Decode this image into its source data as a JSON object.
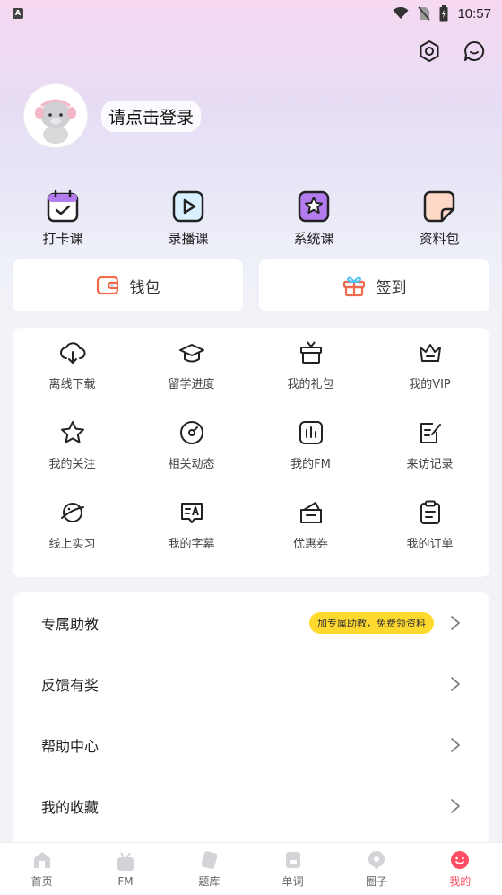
{
  "status_bar": {
    "time": "10:57",
    "badge": "A"
  },
  "profile": {
    "login_text": "请点击登录"
  },
  "quick_actions": [
    {
      "label": "打卡课",
      "icon": "calendar-check-icon"
    },
    {
      "label": "录播课",
      "icon": "play-icon"
    },
    {
      "label": "系统课",
      "icon": "star-box-icon"
    },
    {
      "label": "资料包",
      "icon": "note-icon"
    }
  ],
  "wallet": {
    "wallet_label": "钱包",
    "checkin_label": "签到"
  },
  "grid_items": [
    {
      "label": "离线下载",
      "icon": "cloud-download-icon"
    },
    {
      "label": "留学进度",
      "icon": "graduation-cap-icon"
    },
    {
      "label": "我的礼包",
      "icon": "gift-icon"
    },
    {
      "label": "我的VIP",
      "icon": "crown-icon"
    },
    {
      "label": "我的关注",
      "icon": "star-icon"
    },
    {
      "label": "相关动态",
      "icon": "compass-icon"
    },
    {
      "label": "我的FM",
      "icon": "chart-icon"
    },
    {
      "label": "来访记录",
      "icon": "edit-note-icon"
    },
    {
      "label": "线上实习",
      "icon": "planet-icon"
    },
    {
      "label": "我的字幕",
      "icon": "subtitle-icon"
    },
    {
      "label": "优惠券",
      "icon": "coupon-icon"
    },
    {
      "label": "我的订单",
      "icon": "clipboard-icon"
    }
  ],
  "list_items": [
    {
      "label": "专属助教",
      "badge": "加专属助教，免费领资料"
    },
    {
      "label": "反馈有奖"
    },
    {
      "label": "帮助中心"
    },
    {
      "label": "我的收藏"
    }
  ],
  "tabbar": [
    {
      "label": "首页"
    },
    {
      "label": "FM"
    },
    {
      "label": "题库"
    },
    {
      "label": "单词"
    },
    {
      "label": "圈子"
    },
    {
      "label": "我的"
    }
  ],
  "colors": {
    "accent": "#ff4d63",
    "badge_yellow": "#ffd92e",
    "wallet_icon": "#f06a4d"
  }
}
